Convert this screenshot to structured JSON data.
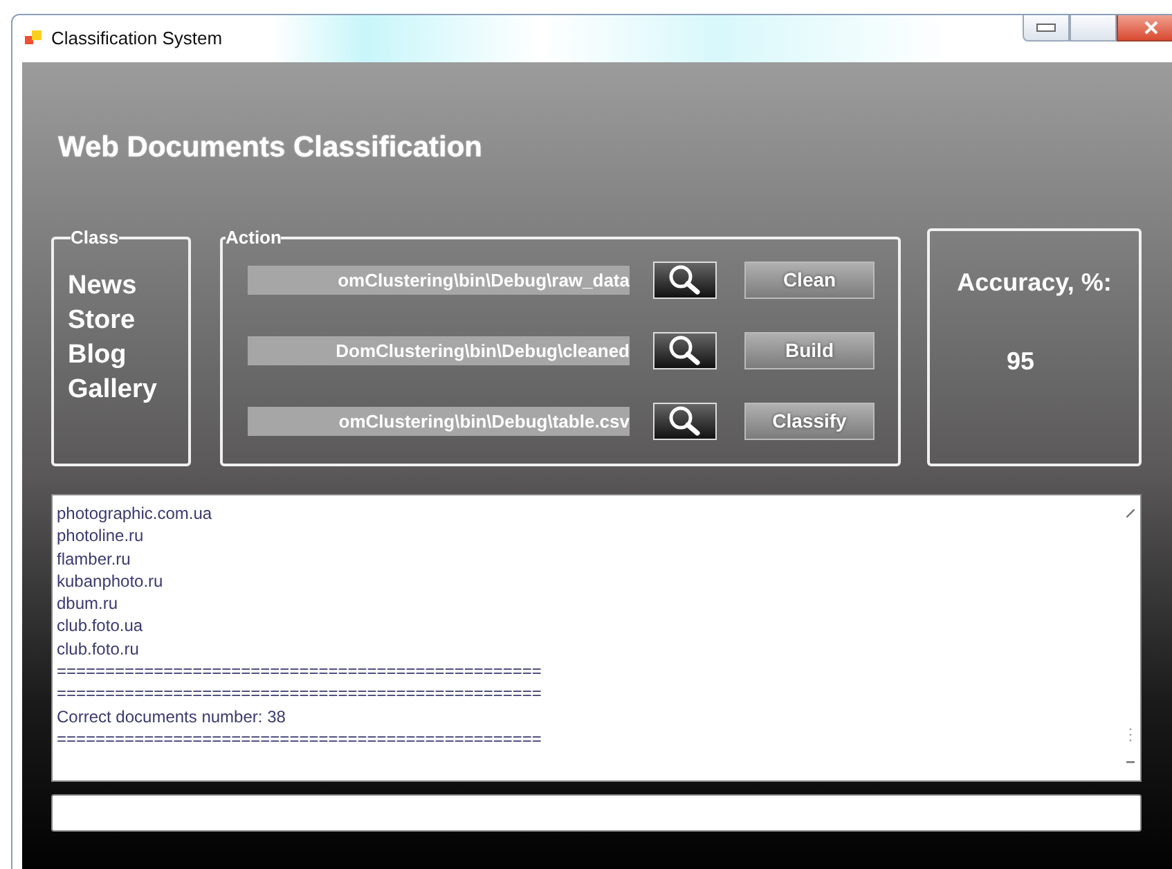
{
  "window": {
    "title": "Classification System"
  },
  "heading": "Web Documents Classification",
  "class_group": {
    "label": "Class",
    "items": [
      "News",
      "Store",
      "Blog",
      "Gallery"
    ]
  },
  "action_group": {
    "label": "Action",
    "rows": [
      {
        "path": "omClustering\\bin\\Debug\\raw_data",
        "button": "Clean"
      },
      {
        "path": "DomClustering\\bin\\Debug\\cleaned",
        "button": "Build"
      },
      {
        "path": "omClustering\\bin\\Debug\\table.csv",
        "button": "Classify"
      }
    ]
  },
  "accuracy": {
    "label": "Accuracy, %:",
    "value": "95"
  },
  "log": {
    "lines": [
      "photographic.com.ua",
      "photoline.ru",
      "flamber.ru",
      "kubanphoto.ru",
      "dbum.ru",
      "club.foto.ua",
      "club.foto.ru",
      "==================================================",
      "==================================================",
      "Correct documents number: 38",
      "=================================================="
    ]
  }
}
